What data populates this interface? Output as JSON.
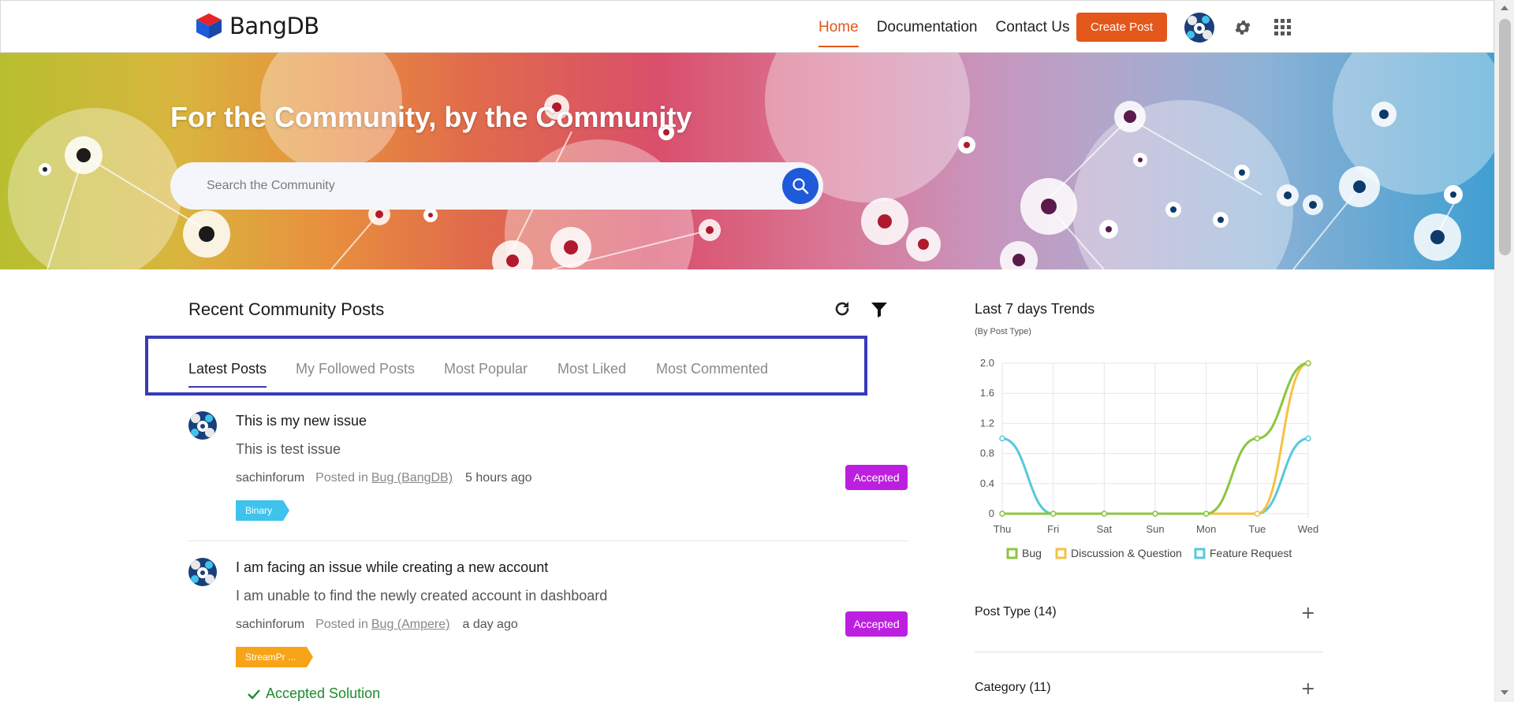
{
  "header": {
    "logo_text": "BangDB",
    "nav": [
      "Home",
      "Documentation",
      "Contact Us"
    ],
    "create_post_label": "Create Post"
  },
  "hero": {
    "title": "For the Community, by the Community",
    "search_placeholder": "Search the Community"
  },
  "posts_section": {
    "title": "Recent Community Posts",
    "tabs": [
      "Latest Posts",
      "My Followed Posts",
      "Most Popular",
      "Most Liked",
      "Most Commented"
    ],
    "active_tab": "Latest Posts"
  },
  "posts": [
    {
      "title": "This is my new issue",
      "body": "This is test issue",
      "author": "sachinforum",
      "posted_in_label": "Posted in",
      "category": "Bug (BangDB)",
      "time": "5 hours ago",
      "status": "Accepted",
      "tag": "Binary",
      "tag_color": "#3ec3ec"
    },
    {
      "title": "I am facing an issue while creating a new account",
      "body": "I am unable to find the newly created account in dashboard",
      "author": "sachinforum",
      "posted_in_label": "Posted in",
      "category": "Bug (Ampere)",
      "time": "a day ago",
      "status": "Accepted",
      "tag": "StreamPr ...",
      "tag_color": "#f7a418",
      "accepted_solution": "Accepted Solution"
    }
  ],
  "trends": {
    "title": "Last 7 days Trends",
    "subtitle": "(By Post Type)"
  },
  "chart_data": {
    "type": "line",
    "x": [
      "Thu",
      "Fri",
      "Sat",
      "Sun",
      "Mon",
      "Tue",
      "Wed"
    ],
    "yticks": [
      "2.0",
      "1.6",
      "1.2",
      "0.8",
      "0.4",
      "0"
    ],
    "ylim": [
      0,
      2
    ],
    "grid": true,
    "legend_position": "bottom",
    "series": [
      {
        "name": "Bug",
        "color": "#8cc63f",
        "values": [
          0,
          0,
          0,
          0,
          0,
          1,
          2
        ]
      },
      {
        "name": "Discussion & Question",
        "color": "#f5c242",
        "values": [
          0,
          0,
          0,
          0,
          0,
          0,
          2
        ]
      },
      {
        "name": "Feature Request",
        "color": "#56c8dc",
        "values": [
          1,
          0,
          0,
          0,
          0,
          0,
          1
        ]
      }
    ]
  },
  "filters": [
    {
      "label": "Post Type (14)"
    },
    {
      "label": "Category (11)"
    }
  ],
  "colors": {
    "brand_orange": "#e4571a",
    "accepted_purple": "#bd1fe0",
    "search_blue": "#1e5ad9",
    "tab_highlight": "#3a3ab8"
  }
}
